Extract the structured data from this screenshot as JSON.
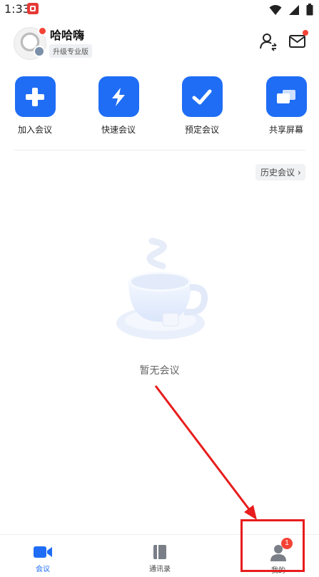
{
  "status_bar": {
    "time": "1:33"
  },
  "header": {
    "user_name": "哈哈嗨",
    "upgrade_label": "升级专业版"
  },
  "actions": [
    {
      "label": "加入会议",
      "icon": "plus-icon"
    },
    {
      "label": "快速会议",
      "icon": "lightning-icon"
    },
    {
      "label": "预定会议",
      "icon": "check-icon"
    },
    {
      "label": "共享屏幕",
      "icon": "share-screen-icon"
    }
  ],
  "history_label": "历史会议 ›",
  "empty_state": {
    "text": "暂无会议"
  },
  "tabs": [
    {
      "label": "会议",
      "active": true
    },
    {
      "label": "通讯录",
      "active": false
    },
    {
      "label": "我的",
      "active": false,
      "badge": "1"
    }
  ],
  "colors": {
    "accent": "#1f6df5",
    "annotation": "#e81c1c",
    "badge": "#f44336"
  }
}
